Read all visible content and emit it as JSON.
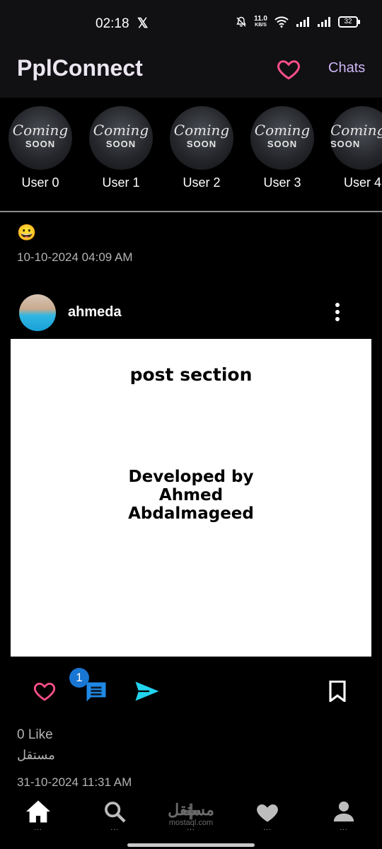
{
  "status_bar": {
    "time": "02:18",
    "x_icon": "x-logo",
    "net_speed_value": "11.0",
    "net_speed_unit": "KB/S",
    "battery": "32"
  },
  "app": {
    "title": "PplConnect",
    "chats_label": "Chats",
    "accent": "#ff4f8b",
    "chats_color": "#cdb7f5"
  },
  "stories": [
    {
      "name": "User 0",
      "placeholder_line1": "Coming",
      "placeholder_line2": "SOON"
    },
    {
      "name": "User 1",
      "placeholder_line1": "Coming",
      "placeholder_line2": "SOON"
    },
    {
      "name": "User 2",
      "placeholder_line1": "Coming",
      "placeholder_line2": "SOON"
    },
    {
      "name": "User 3",
      "placeholder_line1": "Coming",
      "placeholder_line2": "SOON"
    },
    {
      "name": "User 4",
      "placeholder_line1": "Coming",
      "placeholder_line2": "SOON"
    }
  ],
  "previous_post": {
    "emoji": "😀",
    "timestamp": "10-10-2024 04:09 AM"
  },
  "post": {
    "username": "ahmeda",
    "image_title": "post section",
    "image_body": "Developed by\nAhmed\nAbdalmageed",
    "comment_badge": "1",
    "likes": "0 Like",
    "caption": "مستقل",
    "timestamp": "31-10-2024 11:31 AM"
  },
  "bottom_nav": {
    "items": [
      "home-icon",
      "search-icon",
      "add-icon",
      "favorites-icon",
      "profile-icon"
    ],
    "watermark_line1": "مستقل",
    "watermark_line2": "mostaql.com",
    "more_dots": "..."
  }
}
